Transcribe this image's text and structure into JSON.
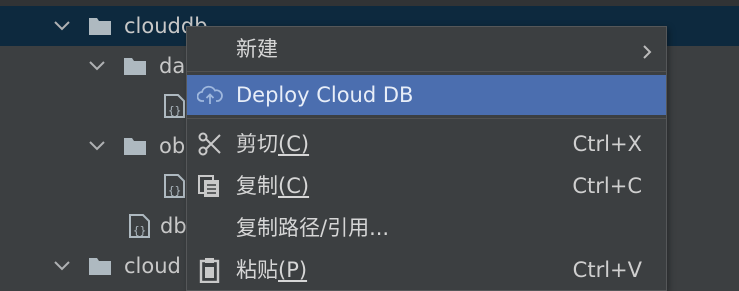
{
  "tree": {
    "rows": [
      {
        "label": "clouddb",
        "type": "folder",
        "expanded": true,
        "selected": true
      },
      {
        "label": "da",
        "type": "folder",
        "expanded": true
      },
      {
        "label": "",
        "type": "json-file"
      },
      {
        "label": "ob",
        "type": "folder",
        "expanded": true
      },
      {
        "label": "",
        "type": "json-file"
      },
      {
        "label": "db",
        "type": "json-file"
      },
      {
        "label": "cloud",
        "type": "folder",
        "expanded": true
      }
    ]
  },
  "context_menu": {
    "items": [
      {
        "label": "新建",
        "shortcut": "",
        "icon": "",
        "submenu": true
      },
      {
        "label": "Deploy Cloud DB",
        "shortcut": "",
        "icon": "cloud-upload-icon",
        "active": true
      },
      {
        "label_main": "剪切",
        "label_mnemonic": "(C)",
        "shortcut": "Ctrl+X",
        "icon": "scissors-icon"
      },
      {
        "label_main": "复制",
        "label_mnemonic": "(C)",
        "shortcut": "Ctrl+C",
        "icon": "copy-icon"
      },
      {
        "label": "复制路径/引用...",
        "shortcut": "",
        "icon": ""
      },
      {
        "label_main": "粘贴",
        "label_mnemonic": "(P)",
        "shortcut": "Ctrl+V",
        "icon": "paste-icon"
      }
    ]
  },
  "colors": {
    "background": "#3c3f41",
    "selection": "#0d293e",
    "menu_highlight": "#4b6eaf"
  }
}
